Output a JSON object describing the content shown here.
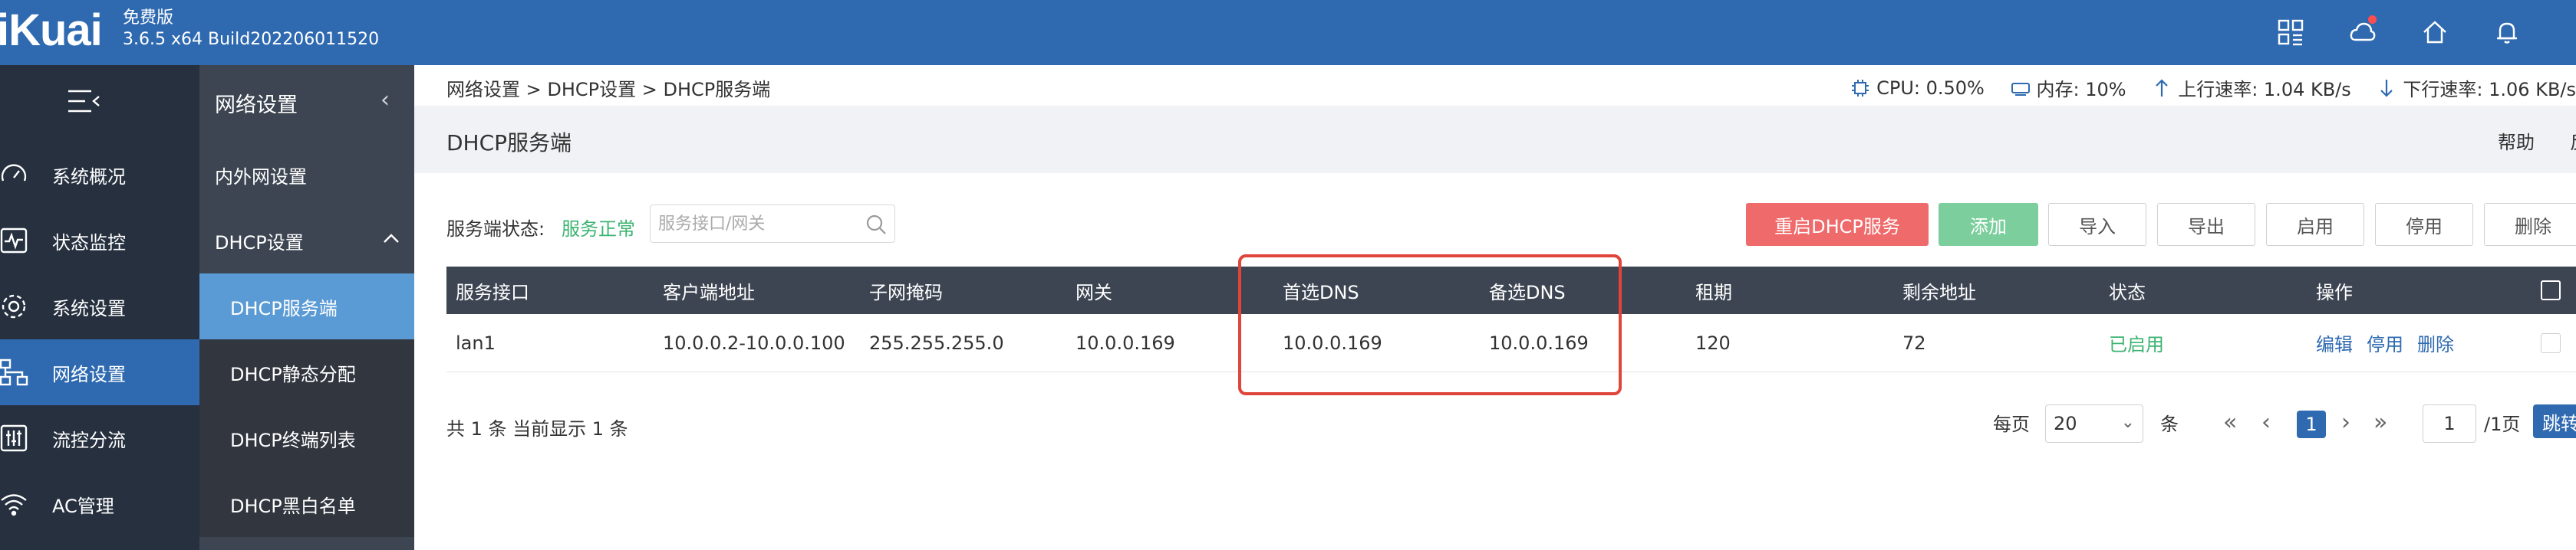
{
  "header": {
    "logo": "iKuai",
    "edition": "免费版",
    "build": "3.6.5 x64 Build202206011520"
  },
  "sidebar": {
    "items": [
      {
        "label": "系统概况",
        "icon": "gauge-icon"
      },
      {
        "label": "状态监控",
        "icon": "pulse-icon"
      },
      {
        "label": "系统设置",
        "icon": "gear-icon"
      },
      {
        "label": "网络设置",
        "icon": "network-icon"
      },
      {
        "label": "流控分流",
        "icon": "sliders-icon"
      },
      {
        "label": "AC管理",
        "icon": "wifi-icon"
      }
    ]
  },
  "subnav": {
    "title": "网络设置",
    "items": [
      {
        "label": "内外网设置"
      },
      {
        "label": "DHCP设置"
      },
      {
        "label": "DHCP服务端"
      },
      {
        "label": "DHCP静态分配"
      },
      {
        "label": "DHCP终端列表"
      },
      {
        "label": "DHCP黑白名单"
      }
    ]
  },
  "breadcrumb": "网络设置 > DHCP设置 > DHCP服务端",
  "stats": {
    "cpu": "CPU: 0.50%",
    "mem": "内存: 10%",
    "up": "上行速率: 1.04 KB/s",
    "down": "下行速率: 1.06 KB/s"
  },
  "page": {
    "title": "DHCP服务端",
    "help": "帮助",
    "feedback": "反馈"
  },
  "toolbar": {
    "status_label": "服务端状态:",
    "status_value": "服务正常",
    "search_placeholder": "服务接口/网关",
    "restart": "重启DHCP服务",
    "add": "添加",
    "import": "导入",
    "export": "导出",
    "enable": "启用",
    "disable": "停用",
    "delete": "删除"
  },
  "table": {
    "headers": [
      "服务接口",
      "客户端地址",
      "子网掩码",
      "网关",
      "首选DNS",
      "备选DNS",
      "租期",
      "剩余地址",
      "状态",
      "操作"
    ],
    "rows": [
      {
        "iface": "lan1",
        "range": "10.0.0.2-10.0.0.100",
        "mask": "255.255.255.0",
        "gateway": "10.0.0.169",
        "dns1": "10.0.0.169",
        "dns2": "10.0.0.169",
        "lease": "120",
        "remain": "72",
        "status": "已启用",
        "edit": "编辑",
        "disable": "停用",
        "delete": "删除"
      }
    ]
  },
  "footer": {
    "total": "共 1 条 当前显示 1 条",
    "per_page_label": "每页",
    "per_page_value": "20",
    "per_page_unit": "条",
    "current_page": "1",
    "page_input": "1",
    "total_pages": "/1页",
    "jump": "跳转"
  },
  "colors": {
    "header_blue": "#2f6ab1",
    "sidebar_dark": "#26303f",
    "subnav": "#3d4552",
    "active_sub": "#5b9bd5",
    "restart_red": "#ef6a6a",
    "add_green": "#7ccf9d",
    "status_green": "#3cb371",
    "highlight_red": "#e0453a"
  }
}
